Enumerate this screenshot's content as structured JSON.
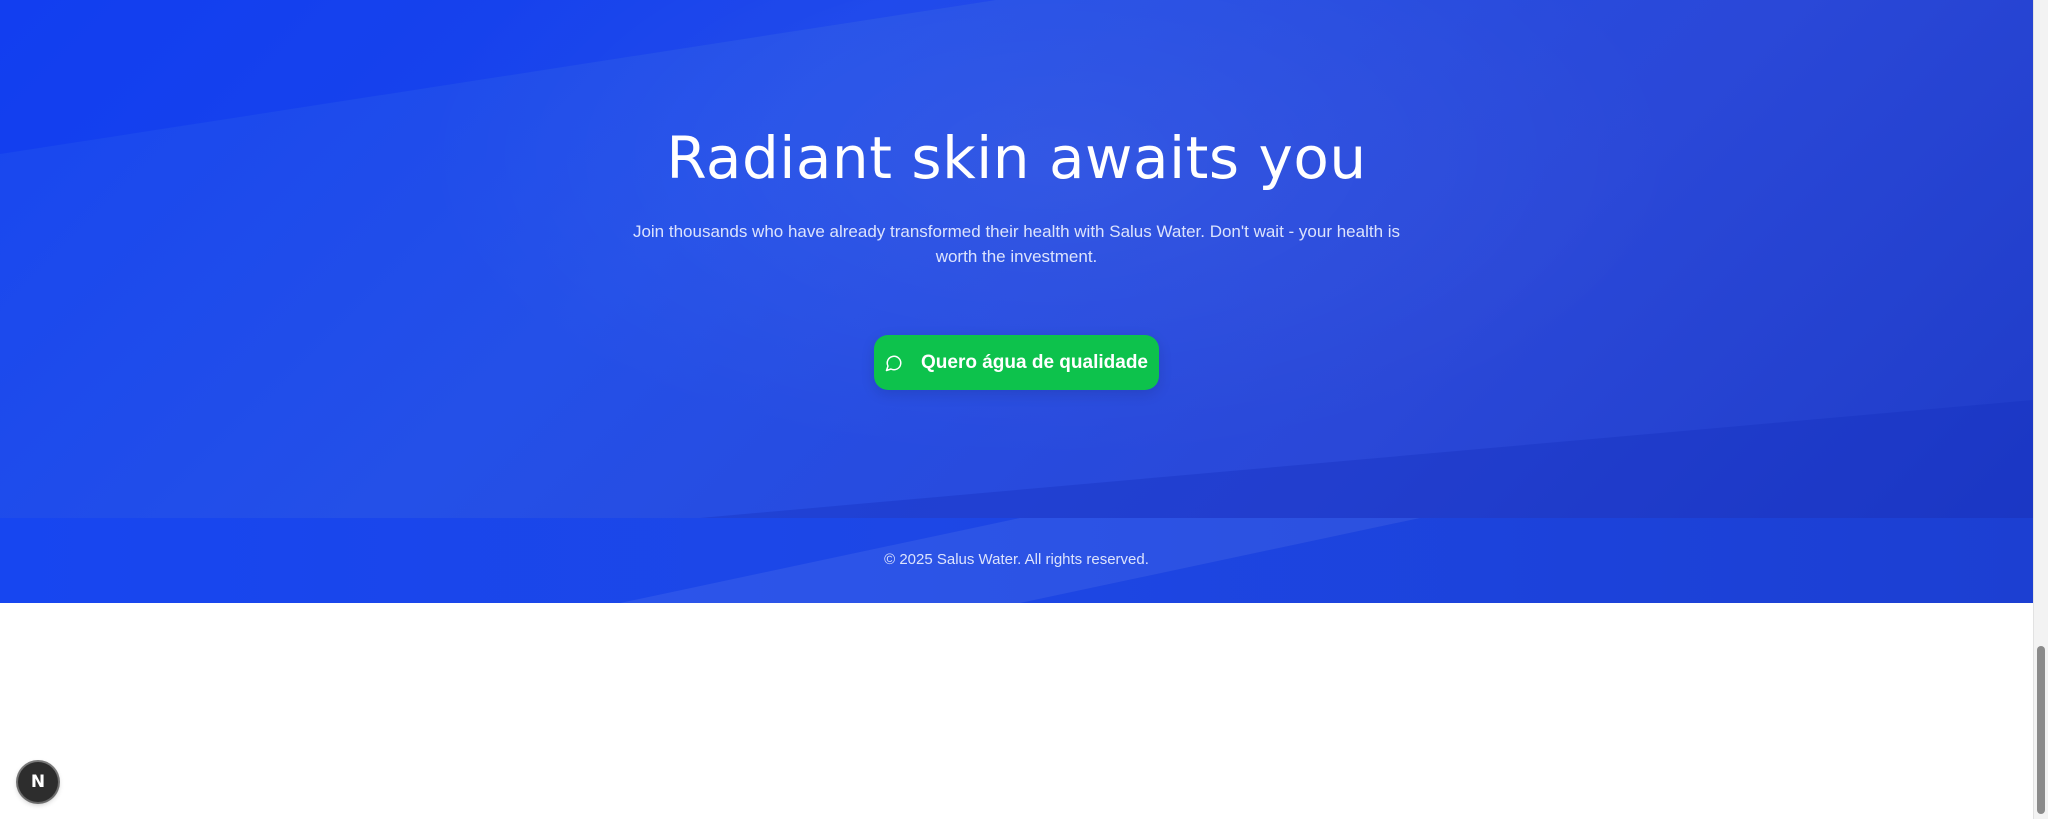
{
  "cta": {
    "title": "Radiant skin awaits you",
    "subtitle": "Join thousands who have already transformed their health with Salus Water. Don't wait - your health is worth the investment.",
    "button_label": "Quero água de qualidade",
    "button_icon": "chat-bubble-icon",
    "button_color": "#0dc24c",
    "background_color": "#1f4ae8"
  },
  "footer": {
    "copyright": "© 2025 Salus Water. All rights reserved."
  },
  "dev_badge": {
    "label": "N",
    "icon": "nextjs-icon"
  },
  "colors": {
    "accent_blue": "#1746f0",
    "whatsapp_green": "#0dc24c",
    "text_light": "#ebf0ff"
  }
}
